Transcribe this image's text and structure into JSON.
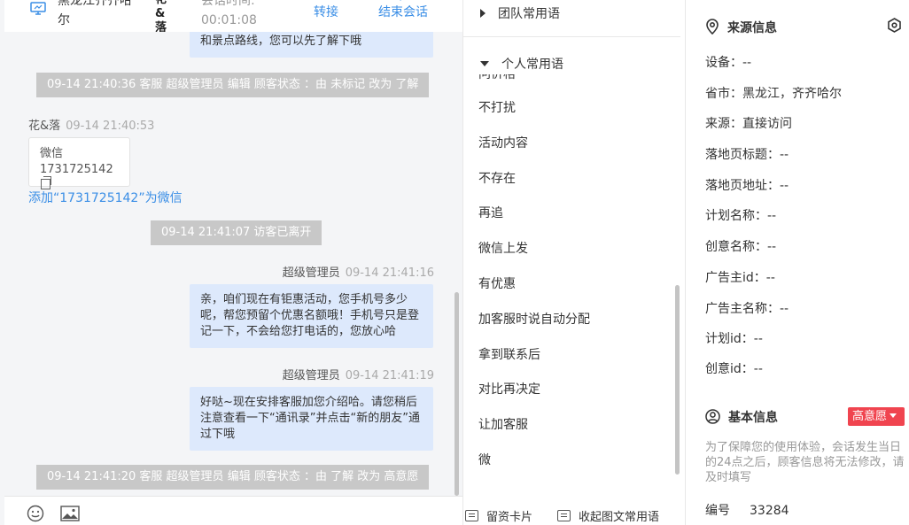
{
  "topbar": {
    "visitor_name": "黑龙江齐齐哈尔",
    "visitor_nick": "花&落",
    "session_time_label": "会话时间:",
    "session_time": "00:01:08",
    "transfer_label": "转接",
    "end_label": "结束会话"
  },
  "chat": {
    "partial_bubble": "和景点路线，您可以先了解下哦",
    "sys1": "09-14 21:40:36 客服 超级管理员 编辑 顾客状态 ：由 未标记 改为 了解",
    "visitor_sender": "花&落",
    "visitor_time": "09-14 21:40:53",
    "card_title": "微信",
    "card_value": "1731725142",
    "add_link": "添加“1731725142”为微信",
    "sys_left": "09-14 21:41:07 访客已离开",
    "agent1_name": "超级管理员",
    "agent1_time": "09-14 21:41:16",
    "agent1_msg": "亲，咱们现在有钜惠活动，您手机号多少呢，帮您预留个优惠名额哦！手机号只是登记一下，不会给您打电话的，您放心哈",
    "agent2_name": "超级管理员",
    "agent2_time": "09-14 21:41:19",
    "agent2_msg": "好哒~现在安排客服加您介绍哈。请您稍后注意查看一下“通讯录”并点击“新的朋友”通过下哦",
    "sys2": "09-14 21:41:20 客服 超级管理员 编辑 顾客状态 ：由 了解 改为 高意愿"
  },
  "phrases": {
    "team_group": "团队常用语",
    "personal_group": "个人常用语",
    "items": [
      "问价格",
      "不打扰",
      "活动内容",
      "不存在",
      "再追",
      "微信上发",
      "有优惠",
      "加客服时说自动分配",
      "拿到联系后",
      "对比再决定",
      "让加客服",
      "微"
    ],
    "bottom_card": "留资卡片",
    "bottom_collapse": "收起图文常用语"
  },
  "info": {
    "source_title": "来源信息",
    "fields": [
      "设备：--",
      "省市：黑龙江，齐齐哈尔",
      "来源：直接访问",
      "落地页标题：--",
      "落地页地址：--",
      "计划名称：--",
      "创意名称：--",
      "广告主id：--",
      "广告主名称：--",
      "计划id：--",
      "创意id：--"
    ],
    "basic_title": "基本信息",
    "intent_badge": "高意愿",
    "note": "为了保障您的使用体验，会话发生当日的24点之后，顾客信息将无法修改，请及时填写",
    "serial_label": "编号",
    "serial_value": "33284"
  },
  "colors": {
    "accent": "#3a8ee6",
    "bubble": "#dde9fc",
    "system_message": "#c8c8c8",
    "intent_badge": "#f0444f"
  }
}
